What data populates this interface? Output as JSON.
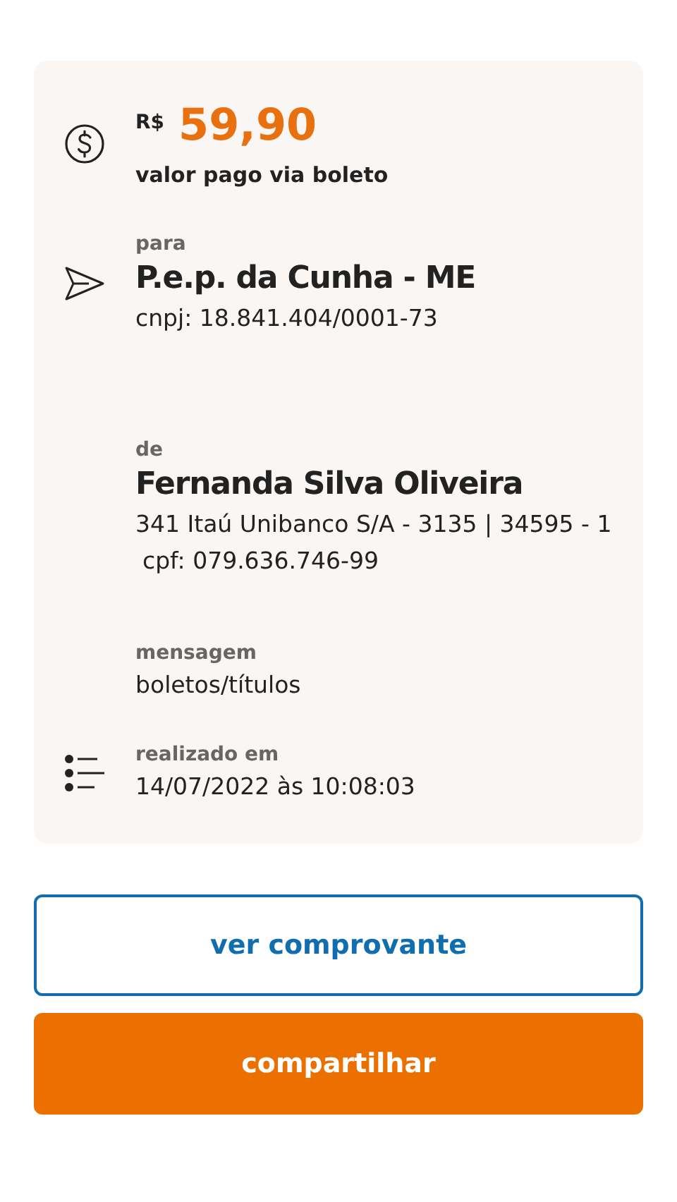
{
  "amount": {
    "currency": "R$",
    "value": "59,90",
    "caption": "valor pago via boleto"
  },
  "details": [
    {
      "label": "para",
      "name": "P.e.p. da Cunha - ME",
      "lines": [
        "cnpj: 18.841.404/0001-73"
      ]
    },
    {
      "label": "de",
      "name": "Fernanda Silva Oliveira",
      "lines": [
        "341 Itaú Unibanco S/A - 3135 | 34595 - 1",
        "cpf: 079.636.746-99"
      ]
    },
    {
      "label": "mensagem",
      "lines": [
        "boletos/títulos"
      ]
    },
    {
      "label": "realizado em",
      "lines": [
        "14/07/2022 às 10:08:03"
      ]
    }
  ],
  "buttons": [
    {
      "kind": "outline",
      "label": "ver comprovante"
    },
    {
      "kind": "filled",
      "label": "compartilhar"
    }
  ]
}
